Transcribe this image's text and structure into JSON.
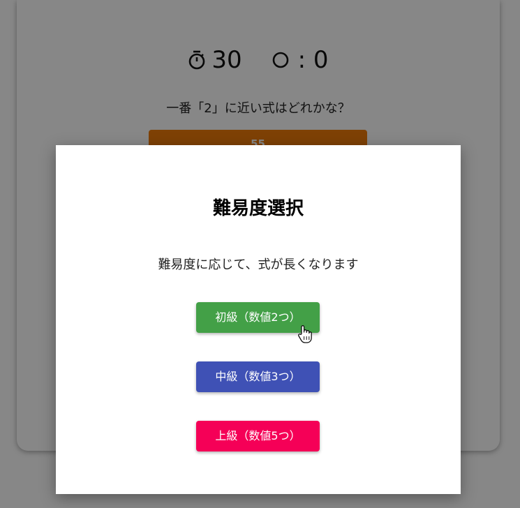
{
  "game": {
    "timer_value": "30",
    "score_value": ": 0",
    "question": "一番「2」に近い式はどれかな？",
    "answer_option": "55"
  },
  "dialog": {
    "title": "難易度選択",
    "description": "難易度に応じて、式が長くなります",
    "buttons": {
      "easy": "初級（数値2つ）",
      "medium": "中級（数値3つ）",
      "hard": "上級（数値5つ）"
    }
  },
  "colors": {
    "easy": "#43a047",
    "medium": "#3f51b5",
    "hard": "#f50057",
    "answer": "#ef7c0a"
  },
  "icons": {
    "timer": "stopwatch-icon",
    "score": "circle-icon",
    "cursor": "hand-pointer-icon"
  }
}
